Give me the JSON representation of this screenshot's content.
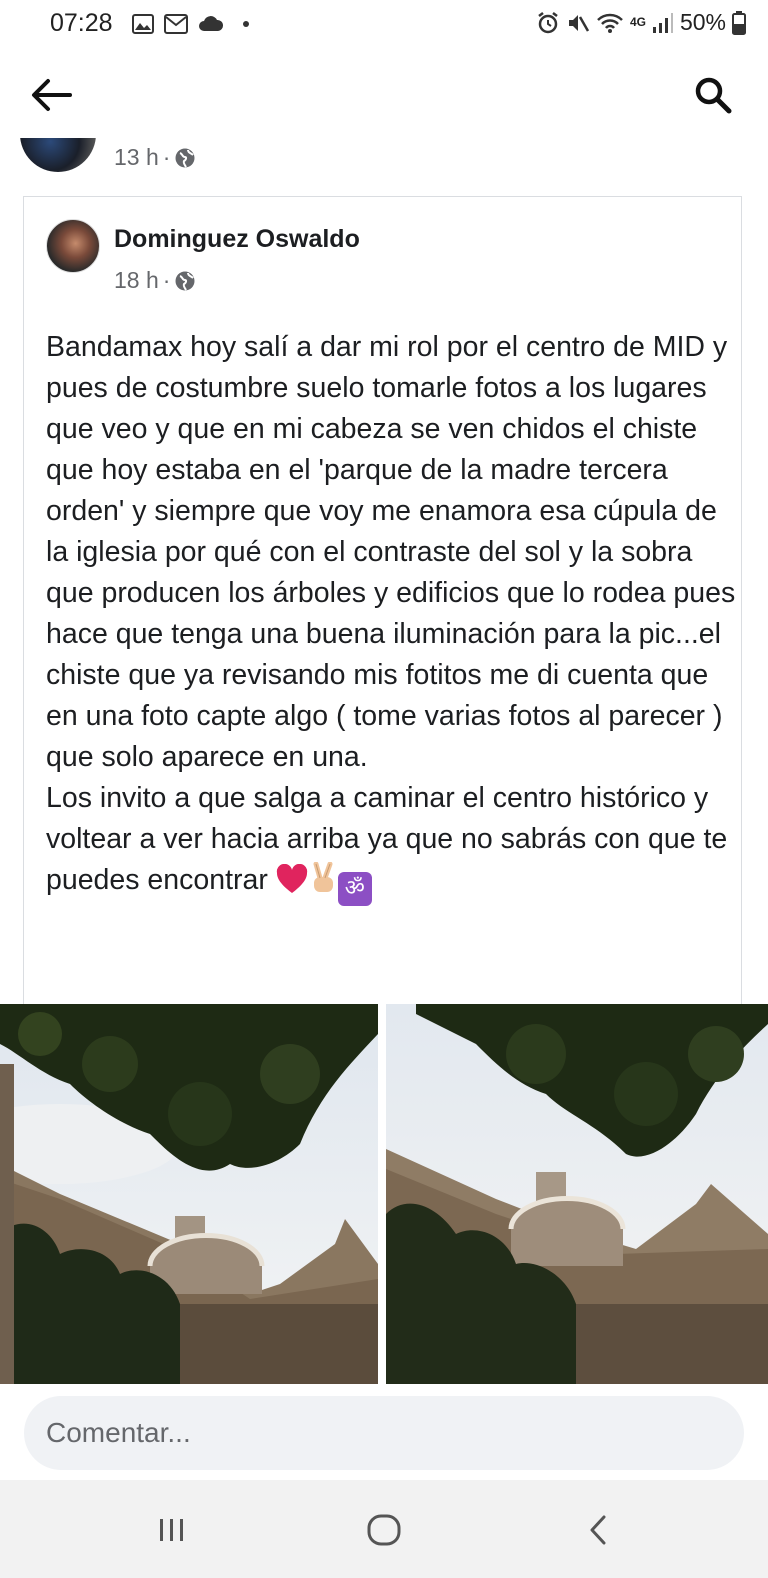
{
  "status_bar": {
    "time": "07:28",
    "left_icons": [
      "image-icon",
      "mail-icon",
      "cloud-icon",
      "dot-icon"
    ],
    "right_icons": [
      "alarm-icon",
      "mute-icon",
      "wifi-icon",
      "4g-signal-icon",
      "signal-bars-icon",
      "battery-icon"
    ],
    "network_label": "4G",
    "battery": "50%"
  },
  "app_bar": {
    "back_icon": "arrow-left-icon",
    "search_icon": "search-icon"
  },
  "parent_post": {
    "time": "13 h",
    "separator": "·",
    "privacy_icon": "globe-icon"
  },
  "shared_post": {
    "author": "Dominguez Oswaldo",
    "time": "18 h",
    "separator": "·",
    "privacy_icon": "globe-icon",
    "body": "Bandamax hoy salí a dar mi rol por el centro de MID y pues de costumbre suelo tomarle fotos a los lugares  que veo y que en mi cabeza se ven chidos  el chiste que hoy estaba en el 'parque de la madre tercera orden'  y siempre que voy me enamora esa cúpula de la iglesia por qué con el contraste del sol y la sobra que producen los árboles y edificios que lo rodea pues hace que tenga una buena iluminación para la pic...el chiste que ya revisando mis fotitos me di cuenta que en una foto capte algo ( tome varias fotos al parecer ) que solo aparece en una.\nLos invito a que salga a caminar el centro histórico y voltear a ver hacia arriba ya que no sabrás con que te puedes encontrar ",
    "emojis": [
      "heart-emoji",
      "peace-hand-emoji",
      "om-emoji"
    ],
    "om_glyph": "ॐ",
    "photos": [
      "church-dome-photo-1",
      "church-dome-photo-2"
    ]
  },
  "comment": {
    "placeholder": "Comentar..."
  },
  "nav_bar": {
    "buttons": [
      "recents-icon",
      "home-icon",
      "back-icon"
    ]
  },
  "colors": {
    "text": "#1c1e21",
    "meta": "#65676b",
    "comment_bg": "#f0f2f5",
    "heart": "#e0245e",
    "om_bg": "#8c4fc4",
    "nav_bg": "#f2f2f2"
  }
}
